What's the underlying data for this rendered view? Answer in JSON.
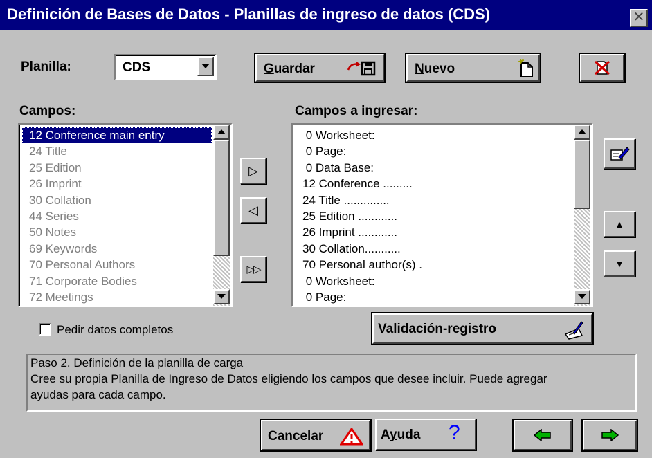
{
  "window": {
    "title": "Definición de Bases de Datos  - Planillas de ingreso de datos (CDS)",
    "close_glyph": "✕"
  },
  "toolbar": {
    "planilla_label": "Planilla:",
    "planilla_value": "CDS",
    "guardar_mnemonic": "G",
    "guardar_rest": "uardar",
    "nuevo_mnemonic": "N",
    "nuevo_rest": "uevo"
  },
  "campos": {
    "label": "Campos:",
    "items": [
      "12 Conference main entry",
      "24 Title",
      "25 Edition",
      "26 Imprint",
      "30 Collation",
      "44 Series",
      "50 Notes",
      "69 Keywords",
      "70 Personal Authors",
      "71 Corporate Bodies",
      "72 Meetings"
    ],
    "selected_index": 0
  },
  "campos_ingresar": {
    "label": "Campos a ingresar:",
    "items": [
      " 0 Worksheet:",
      " 0 Page:",
      " 0 Data Base:",
      "12 Conference .........",
      "24 Title ..............",
      "25 Edition ............",
      "26 Imprint ............",
      "30 Collation...........",
      "70 Personal author(s) .",
      " 0 Worksheet:",
      " 0 Page:"
    ]
  },
  "transfer": {
    "add_glyph": "▷",
    "remove_glyph": "◁",
    "add_all_glyph": "▷▷"
  },
  "order": {
    "up_glyph": "▲",
    "down_glyph": "▼"
  },
  "options": {
    "pedir_label": "Pedir datos completos",
    "pedir_checked": false
  },
  "validacion": {
    "label": "Validación-registro"
  },
  "help": {
    "line1": "Paso 2. Definición de la planilla de carga",
    "line2": "Cree su propia Planilla de Ingreso de Datos eligiendo los campos que desee incluir. Puede agregar",
    "line3": "ayudas para cada campo."
  },
  "footer": {
    "cancelar_mnemonic": "C",
    "cancelar_rest": "ancelar",
    "ayuda_prefix": "A",
    "ayuda_mnemonic": "y",
    "ayuda_rest": "uda",
    "ayuda_glyph": "?",
    "back_glyph": "⇦",
    "next_glyph": "⇨"
  },
  "colors": {
    "titlebar": "#000080",
    "face": "#c0c0c0",
    "selection": "#000080",
    "arrow_green": "#00a000",
    "warning_red": "#e00000",
    "help_blue": "#0000ff"
  }
}
